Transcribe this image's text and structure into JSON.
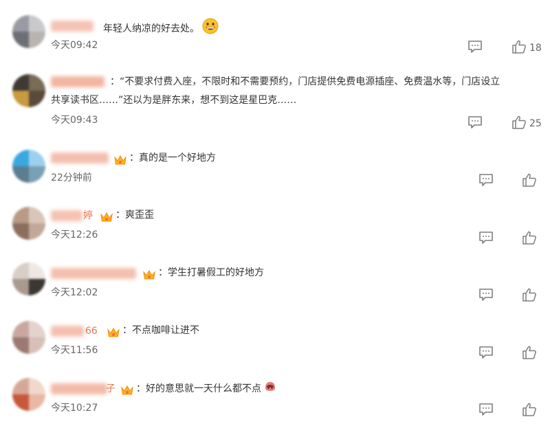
{
  "colors": {
    "username": "#eb7350",
    "text": "#333333",
    "meta": "#666666",
    "icon": "#7d7d7d"
  },
  "comments": [
    {
      "username_visible": "",
      "text": "年轻人纳凉的好去处。",
      "emoji": "grinning-face-emoji",
      "time": "今天09:42",
      "likes": "18",
      "badge": false
    },
    {
      "username_visible": "",
      "text_line1": "：“不要求付费入座，不限时和不需要预约，门店提供免费电源插座、免费温水等，门店设立",
      "text_line2": "共享读书区……”还以为是胖东来，想不到这是星巴克……",
      "time": "今天09:43",
      "likes": "25",
      "badge": false
    },
    {
      "username_visible": "",
      "text": "：真的是一个好地方",
      "time": "22分钟前",
      "badge": true
    },
    {
      "username_visible": "婷",
      "text": "：爽歪歪",
      "time": "今天12:26",
      "badge": true
    },
    {
      "username_visible": "",
      "text": "：学生打暑假工的好地方",
      "time": "今天12:02",
      "badge": true
    },
    {
      "username_visible": "66",
      "text": "：不点咖啡让进不",
      "time": "今天11:56",
      "badge": true
    },
    {
      "username_visible": "子",
      "text": "：好的意思就一天什么都不点",
      "emoji": "shy-face-emoji",
      "time": "今天10:27",
      "badge": true
    }
  ],
  "icons": {
    "reply": "comment-icon",
    "like": "thumbs-up-icon",
    "badge": "vip-crown-badge-icon"
  }
}
